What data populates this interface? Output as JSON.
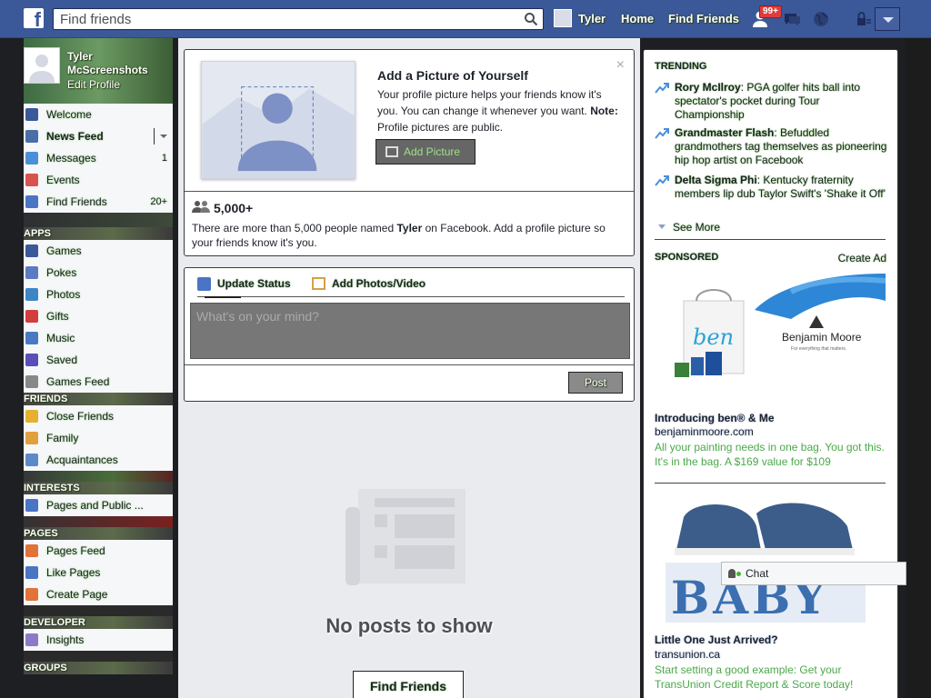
{
  "topbar": {
    "logo": "f",
    "search_placeholder": "Find friends",
    "user": "Tyler",
    "home": "Home",
    "find_friends": "Find Friends",
    "notification_badge": "99+",
    "icons": [
      "search-icon",
      "friend-requests-icon",
      "messages-icon",
      "globe-icon",
      "privacy-lock-icon",
      "chevron-down-icon"
    ]
  },
  "left": {
    "name": "Tyler McScreenshots",
    "edit_profile": "Edit Profile",
    "favorites": [
      {
        "label": "Welcome",
        "count": "",
        "icon": "facebook-icon",
        "color": "#3b5998"
      },
      {
        "label": "News Feed",
        "count": "",
        "icon": "news-feed-icon",
        "color": "#4a6ea8"
      },
      {
        "label": "Messages",
        "count": "1",
        "icon": "messages-icon",
        "color": "#4a90d9"
      },
      {
        "label": "Events",
        "count": "",
        "icon": "calendar-icon",
        "color": "#d9534f"
      },
      {
        "label": "Find Friends",
        "count": "20+",
        "icon": "friends-icon",
        "color": "#4a75c4"
      }
    ],
    "apps_head": "APPS",
    "apps": [
      {
        "label": "Games",
        "icon": "games-icon",
        "color": "#3b5998"
      },
      {
        "label": "Pokes",
        "icon": "poke-icon",
        "color": "#5b7bc2"
      },
      {
        "label": "Photos",
        "icon": "photos-icon",
        "color": "#3d86c6"
      },
      {
        "label": "Gifts",
        "icon": "gift-icon",
        "color": "#d23d3d"
      },
      {
        "label": "Music",
        "icon": "music-icon",
        "color": "#4a79c4"
      },
      {
        "label": "Saved",
        "icon": "bookmark-icon",
        "color": "#5a4fb8"
      },
      {
        "label": "Games Feed",
        "icon": "controller-icon",
        "color": "#888888"
      }
    ],
    "friends_head": "FRIENDS",
    "friends": [
      {
        "label": "Close Friends",
        "icon": "star-icon",
        "color": "#e5b02f"
      },
      {
        "label": "Family",
        "icon": "house-icon",
        "color": "#e0a040"
      },
      {
        "label": "Acquaintances",
        "icon": "list-icon",
        "color": "#5c8ac8"
      }
    ],
    "interests_head": "INTERESTS",
    "interests": [
      {
        "label": "Pages and Public ...",
        "icon": "rss-icon",
        "color": "#4a75c4"
      }
    ],
    "pages_head": "PAGES",
    "pages": [
      {
        "label": "Pages Feed",
        "icon": "flag-icon",
        "color": "#e0723a"
      },
      {
        "label": "Like Pages",
        "icon": "like-icon",
        "color": "#4a75c4"
      },
      {
        "label": "Create Page",
        "icon": "plus-icon",
        "color": "#e0723a"
      }
    ],
    "developer_head": "DEVELOPER",
    "developer": [
      {
        "label": "Insights",
        "icon": "insights-icon",
        "color": "#8a7ac8"
      }
    ],
    "groups_head": "GROUPS"
  },
  "center": {
    "pp_title": "Add a Picture of Yourself",
    "pp_text": "Your profile picture helps your friends know it's you. You can change it whenever you want.",
    "pp_note_label": "Note:",
    "pp_note_text": "Profile pictures are public.",
    "pp_button": "Add Picture",
    "pp_close": "×",
    "people_count": "5,000+",
    "people_note_a": "There are more than 5,000 people named ",
    "people_note_name": "Tyler",
    "people_note_b": " on Facebook. Add a profile picture so your friends know it's you.",
    "update_status": "Update Status",
    "add_photos": "Add Photos/Video",
    "status_placeholder": "What's on your mind?",
    "post_button": "Post",
    "empty_text": "No posts to show",
    "find_friends_button": "Find Friends"
  },
  "right": {
    "trending_head": "TRENDING",
    "trending": [
      {
        "name": "Rory McIlroy",
        "text": ": PGA golfer hits ball into spectator's pocket during Tour Championship"
      },
      {
        "name": "Grandmaster Flash",
        "text": ": Befuddled grandmothers tag themselves as pioneering hip hop artist on Facebook"
      },
      {
        "name": "Delta Sigma Phi",
        "text": ": Kentucky fraternity members lip dub Taylor Swift's 'Shake it Off'"
      }
    ],
    "see_more": "See More",
    "sponsored_head": "SPONSORED",
    "create_ad": "Create Ad",
    "ad1": {
      "brand_text": "Benjamin Moore",
      "brand_tagline": "For everything that matters.",
      "bag_text": "ben",
      "title": "Introducing ben® & Me",
      "url": "benjaminmoore.com",
      "text": "All your painting needs in one bag. You got this. It's in the bag. A $169 value for $109"
    },
    "ad2": {
      "image_text": "BABY",
      "title": "Little One Just Arrived?",
      "url": "transunion.ca",
      "text": "Start setting a good example: Get your TransUnion Credit Report & Score today!"
    }
  },
  "chat": {
    "label": "Chat"
  },
  "colors": {
    "brand": "#3b5998",
    "accent_green": "#42b72a",
    "badge": "#e23b3b"
  }
}
